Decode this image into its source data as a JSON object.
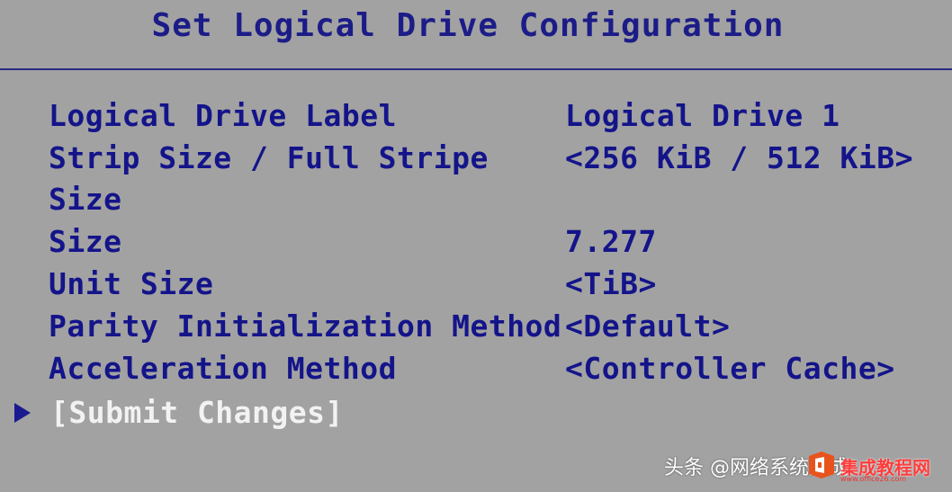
{
  "window": {
    "title": "Set Logical Drive Configuration"
  },
  "settings": [
    {
      "label": "Logical Drive Label",
      "value": "Logical Drive 1"
    },
    {
      "label": "Strip Size / Full Stripe",
      "value": "<256 KiB / 512 KiB>"
    },
    {
      "label": "Size",
      "value": ""
    },
    {
      "label": "Size",
      "value": "7.277"
    },
    {
      "label": "Unit Size",
      "value": "<TiB>"
    },
    {
      "label": "Parity Initialization Method",
      "value": "<Default>"
    },
    {
      "label": "Acceleration Method",
      "value": "<Controller Cache>"
    }
  ],
  "actions": {
    "submit_label": "[Submit Changes]",
    "pointer_icon": "triangle-right-icon"
  },
  "watermark": {
    "text": "头条 @网络系统集成",
    "site": "集成教程网",
    "url": "www.office26.com",
    "logo_icon": "office-logo-icon"
  },
  "colors": {
    "background": "#a2a2a2",
    "text": "#14148a",
    "highlight_text": "#f2f2f2"
  }
}
